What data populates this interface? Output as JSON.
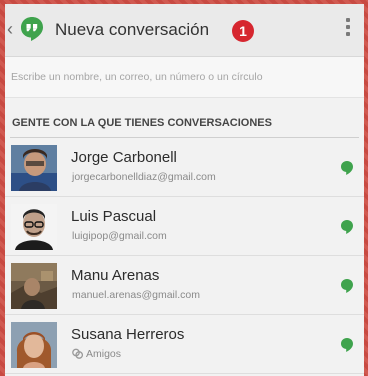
{
  "header": {
    "title": "Nueva conversación",
    "badge": "1"
  },
  "search": {
    "placeholder": "Escribe un nombre, un correo, un número o un círculo"
  },
  "section": {
    "title": "GENTE CON LA QUE TIENES CONVERSACIONES"
  },
  "contacts": [
    {
      "name": "Jorge Carbonell",
      "subtitle": "jorgecarbonelldiaz@gmail.com",
      "status": "online"
    },
    {
      "name": "Luis Pascual",
      "subtitle": "luigipop@gmail.com",
      "status": "online"
    },
    {
      "name": "Manu Arenas",
      "subtitle": "manuel.arenas@gmail.com",
      "status": "online"
    },
    {
      "name": "Susana Herreros",
      "subtitle": "Amigos",
      "status": "online"
    }
  ],
  "colors": {
    "accent_green": "#3fa34d",
    "badge_red": "#d6262f",
    "frame_red": "#c84a42"
  }
}
